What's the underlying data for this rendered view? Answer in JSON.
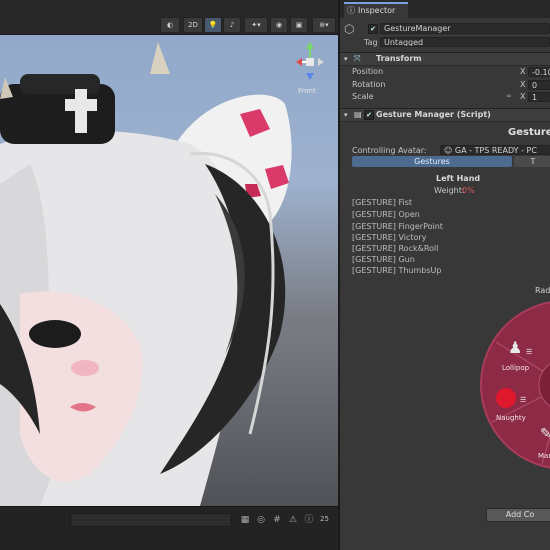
{
  "scene": {
    "toolbar": {
      "btn_2d": "2D",
      "gizmo_front": "Front"
    },
    "bottom": {
      "count": "25"
    }
  },
  "inspector": {
    "tab_label": "Inspector",
    "object": {
      "name": "GestureManager",
      "tag_label": "Tag",
      "tag_value": "Untagged"
    },
    "transform": {
      "title": "Transform",
      "position_label": "Position",
      "rotation_label": "Rotation",
      "scale_label": "Scale",
      "axis_x": "X",
      "position_x": "-0.102",
      "rotation_x": "0",
      "scale_x": "1"
    },
    "component": {
      "title": "Gesture Manager (Script)",
      "heading": "Gesture M",
      "avatar_label": "Controlling Avatar:",
      "avatar_value": "GA - TPS READY - PC",
      "tabs": [
        "Gestures",
        "T"
      ],
      "hand_title": "Left Hand",
      "weight_label": "Weight:",
      "weight_value": "0%",
      "gestures": [
        "[GESTURE] Fist",
        "[GESTURE] Open",
        "[GESTURE] FingerPoint",
        "[GESTURE] Victory",
        "[GESTURE] Rock&Roll",
        "[GESTURE] Gun",
        "[GESTURE] ThumbsUp"
      ],
      "radial_title": "Radi",
      "radial_items": [
        "Lollipop",
        "Naughty",
        "Marker",
        "B"
      ],
      "add_button": "Add Co"
    }
  },
  "colors": {
    "accent_blue": "#4c6b8f",
    "radial_bg": "#8d2a45",
    "weight_red": "#e0555a"
  }
}
